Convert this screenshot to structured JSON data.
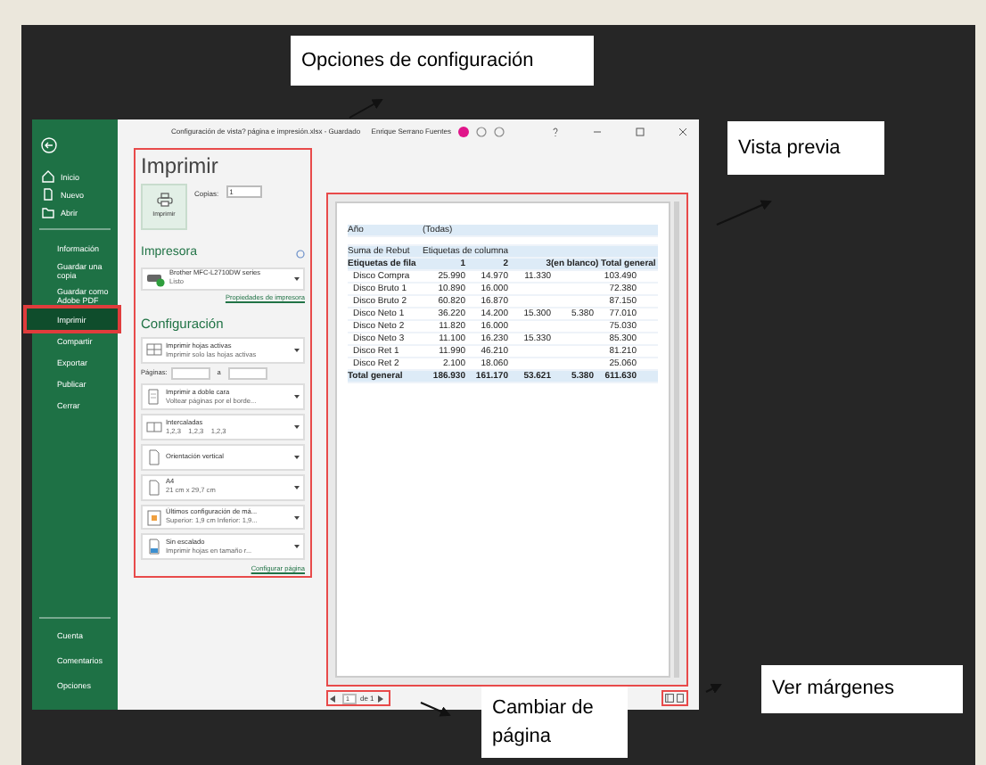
{
  "callouts": [
    {
      "text": "Opciones de configuración"
    },
    {
      "text": "Vista previa"
    },
    {
      "text": "Cambiar de página"
    },
    {
      "text": "Ver márgenes"
    }
  ],
  "window": {
    "title": "Configuración de vista? página e impresión.xlsx - Guardado",
    "user": "Enrique Serrano Fuentes"
  },
  "sidebar": {
    "items": [
      {
        "label": "Inicio",
        "kind": "icon",
        "selected": false
      },
      {
        "label": "Nuevo",
        "kind": "icon",
        "selected": false
      },
      {
        "label": "Abrir",
        "kind": "icon",
        "selected": false
      },
      {
        "label": "Información",
        "kind": "text",
        "selected": false
      },
      {
        "label": "Guardar una copia",
        "kind": "text",
        "selected": false
      },
      {
        "label": "Guardar como Adobe PDF",
        "kind": "text",
        "selected": false
      },
      {
        "label": "Imprimir",
        "kind": "text",
        "selected": true
      },
      {
        "label": "Compartir",
        "kind": "text",
        "selected": false
      },
      {
        "label": "Exportar",
        "kind": "text",
        "selected": false
      },
      {
        "label": "Publicar",
        "kind": "text",
        "selected": false
      },
      {
        "label": "Cerrar",
        "kind": "text",
        "selected": false
      }
    ],
    "bottom_items": [
      {
        "label": "Cuenta",
        "selected": false
      },
      {
        "label": "Comentarios",
        "selected": false
      },
      {
        "label": "Opciones",
        "selected": false
      }
    ]
  },
  "print_panel": {
    "title": "Imprimir",
    "print_button": "Imprimir",
    "copies_label": "Copias:",
    "copies": "1",
    "printer_heading": "Impresora",
    "printer": {
      "name": "Brother MFC-L2710DW series",
      "status": "Listo"
    },
    "printer_link": "Propiedades de impresora",
    "settings_heading": "Configuración",
    "settings": [
      {
        "kind": "dropdown",
        "line1": "Imprimir hojas activas",
        "line2": "Imprimir solo las hojas activas"
      },
      {
        "kind": "pages",
        "label": "Páginas:",
        "separator": "a"
      },
      {
        "kind": "dropdown",
        "line1": "Imprimir a doble cara",
        "line2": "Voltear páginas por el borde..."
      },
      {
        "kind": "dropdown",
        "line1": "Intercaladas",
        "line2": "1,2,3    1,2,3    1,2,3"
      },
      {
        "kind": "dropdown",
        "line1": "Orientación vertical"
      },
      {
        "kind": "dropdown",
        "line1": "A4",
        "line2": "21 cm x 29,7 cm"
      },
      {
        "kind": "dropdown",
        "line1": "Últimos configuración de má...",
        "line2": "Superior: 1,9 cm Inferior: 1,9..."
      },
      {
        "kind": "dropdown",
        "line1": "Sin escalado",
        "line2": "Imprimir hojas en tamaño r..."
      }
    ],
    "setup_link": "Configurar página"
  },
  "preview": {
    "rows": [
      {
        "kind": "filter",
        "cells": [
          "Año",
          "(Todas)"
        ]
      },
      {
        "kind": "blank",
        "cells": []
      },
      {
        "kind": "caption",
        "cells": [
          "Suma de Rebut",
          "Etiquetas de columna"
        ]
      },
      {
        "kind": "header",
        "cells": [
          "Etiquetas de fila",
          "",
          "1",
          "2",
          "3",
          "(en blanco) Total general"
        ]
      },
      {
        "kind": "data",
        "cells": [
          "Disco Compra",
          "",
          "25.990",
          "14.970",
          "11.330",
          "",
          "103.490"
        ]
      },
      {
        "kind": "data",
        "cells": [
          "Disco Bruto 1",
          "",
          "10.890",
          "16.000",
          "",
          "",
          "72.380"
        ]
      },
      {
        "kind": "data",
        "cells": [
          "Disco Bruto 2",
          "",
          "60.820",
          "16.870",
          "",
          "",
          "87.150"
        ]
      },
      {
        "kind": "data",
        "cells": [
          "Disco Neto 1",
          "",
          "36.220",
          "14.200",
          "15.300",
          "5.380",
          "77.010"
        ]
      },
      {
        "kind": "data",
        "cells": [
          "Disco Neto 2",
          "",
          "11.820",
          "16.000",
          "",
          "",
          "75.030"
        ]
      },
      {
        "kind": "data",
        "cells": [
          "Disco Neto 3",
          "",
          "11.100",
          "16.230",
          "15.330",
          "",
          "85.300"
        ]
      },
      {
        "kind": "data",
        "cells": [
          "Disco Ret 1",
          "",
          "11.990",
          "46.210",
          "",
          "",
          "81.210"
        ]
      },
      {
        "kind": "data",
        "cells": [
          "Disco Ret 2",
          "",
          "2.100",
          "18.060",
          "",
          "",
          "25.060"
        ]
      },
      {
        "kind": "total",
        "cells": [
          "Total general",
          "",
          "186.930",
          "161.170",
          "53.621",
          "5.380",
          "611.630"
        ]
      }
    ]
  },
  "page_nav": {
    "current": "1",
    "total": "de 1"
  }
}
